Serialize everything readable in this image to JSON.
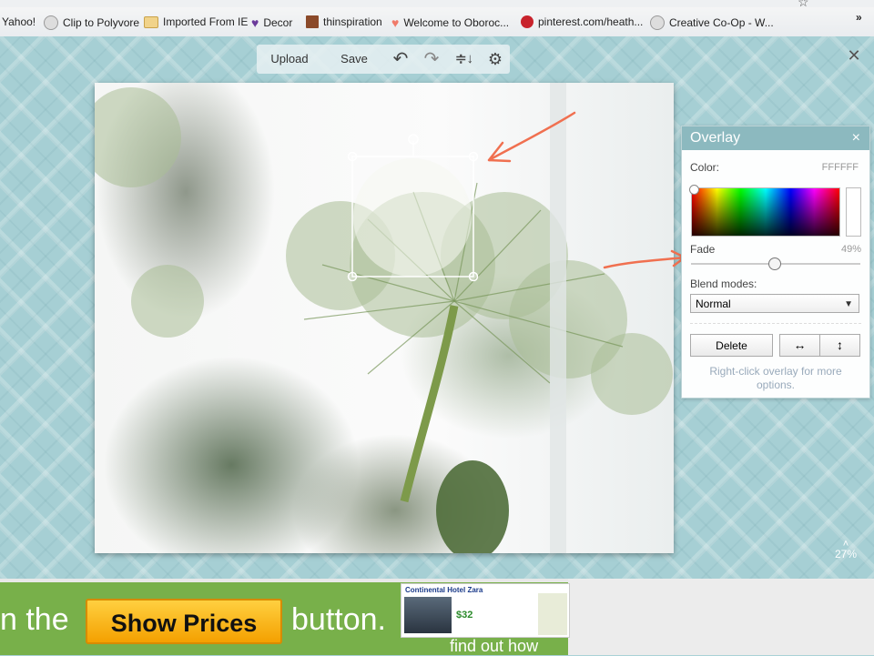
{
  "bookmarks": [
    {
      "label": "Yahoo!",
      "icon": "yahoo-icon"
    },
    {
      "label": "Clip to Polyvore",
      "icon": "globe-icon"
    },
    {
      "label": "Imported From IE",
      "icon": "folder-icon"
    },
    {
      "label": "Decor",
      "icon": "heart-icon"
    },
    {
      "label": "thinspiration",
      "icon": "image-icon"
    },
    {
      "label": "Welcome to Oboroc...",
      "icon": "heart-icon"
    },
    {
      "label": "pinterest.com/heath...",
      "icon": "pinterest-icon"
    },
    {
      "label": "Creative Co-Op - W...",
      "icon": "globe-icon"
    }
  ],
  "bookmarks_overflow": "»",
  "toolbar": {
    "upload_label": "Upload",
    "save_label": "Save",
    "undo_icon": "↶",
    "redo_icon": "↷",
    "layers_icon": "≑↓",
    "settings_icon": "⚙"
  },
  "workspace_close": "✕",
  "overlay_panel": {
    "title": "Overlay",
    "close": "×",
    "color_label": "Color:",
    "color_value": "FFFFFF",
    "fade_label": "Fade",
    "fade_value": "49%",
    "fade_level": 0.49,
    "blend_label": "Blend modes:",
    "blend_selected": "Normal",
    "delete_label": "Delete",
    "flip_h_icon": "↔",
    "flip_v_icon": "↕",
    "hint": "Right-click overlay for more options."
  },
  "zoom": {
    "caret": "˄",
    "value": "27%"
  },
  "ad": {
    "text_left": "n the",
    "button": "Show Prices",
    "text_right": "button.",
    "hotel_name": "Continental Hotel Zara",
    "price": "$32",
    "find": "find out how"
  },
  "colors": {
    "accent": "#8cb9bf",
    "annotation": "#f07050",
    "ad_green": "#78b04a"
  }
}
